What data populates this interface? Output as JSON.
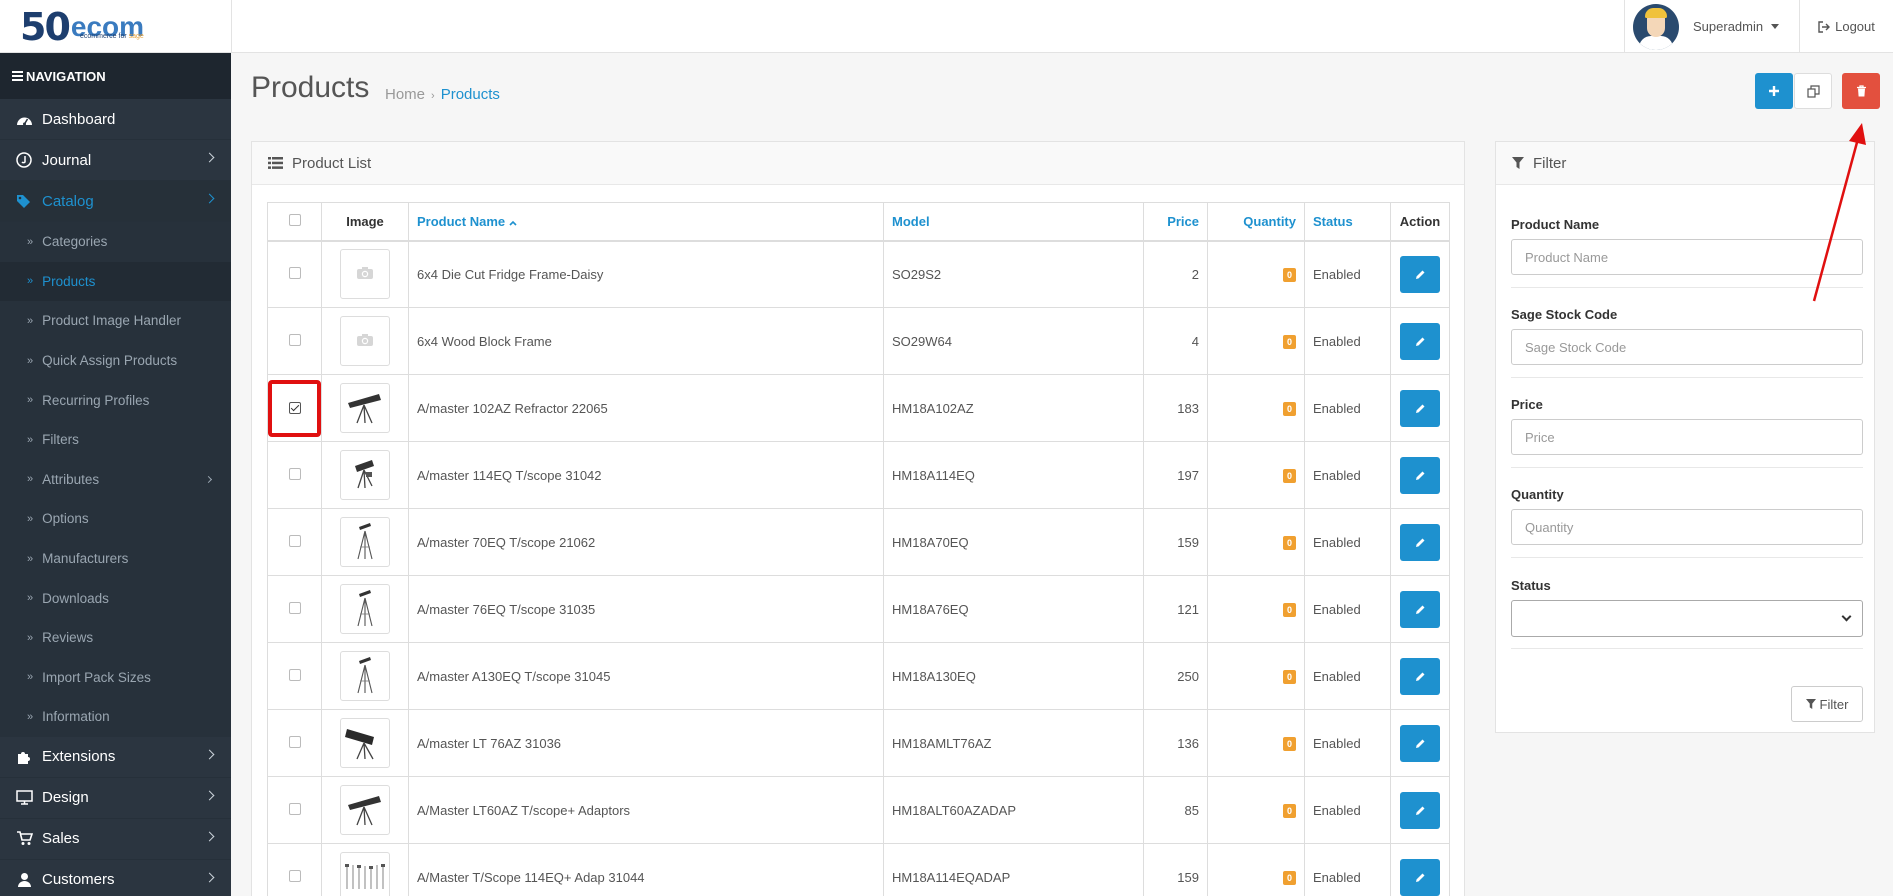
{
  "header": {
    "logo_big": "50",
    "logo_text": "ecom",
    "logo_tag": "ecommerce for",
    "logo_tag_accent": "sage",
    "user_name": "Superadmin",
    "logout_label": "Logout"
  },
  "sidebar": {
    "title": "NAVIGATION",
    "dashboard": "Dashboard",
    "journal": "Journal",
    "catalog": "Catalog",
    "sub": [
      {
        "label": "Categories"
      },
      {
        "label": "Products"
      },
      {
        "label": "Product Image Handler"
      },
      {
        "label": "Quick Assign Products"
      },
      {
        "label": "Recurring Profiles"
      },
      {
        "label": "Filters"
      },
      {
        "label": "Attributes"
      },
      {
        "label": "Options"
      },
      {
        "label": "Manufacturers"
      },
      {
        "label": "Downloads"
      },
      {
        "label": "Reviews"
      },
      {
        "label": "Import Pack Sizes"
      },
      {
        "label": "Information"
      }
    ],
    "extensions": "Extensions",
    "design": "Design",
    "sales": "Sales",
    "customers": "Customers"
  },
  "page": {
    "title": "Products",
    "breadcrumb_home": "Home",
    "breadcrumb_sep": "›",
    "breadcrumb_current": "Products"
  },
  "product_list": {
    "title": "Product List",
    "columns": {
      "image": "Image",
      "name": "Product Name",
      "model": "Model",
      "price": "Price",
      "quantity": "Quantity",
      "status": "Status",
      "action": "Action"
    },
    "rows": [
      {
        "name": "6x4 Die Cut Fridge Frame-Daisy",
        "model": "SO29S2",
        "price": "2",
        "quantity": "0",
        "status": "Enabled",
        "image": "placeholder",
        "checked": false
      },
      {
        "name": "6x4 Wood Block Frame",
        "model": "SO29W64",
        "price": "4",
        "quantity": "0",
        "status": "Enabled",
        "image": "placeholder",
        "checked": false
      },
      {
        "name": "A/master 102AZ Refractor 22065",
        "model": "HM18A102AZ",
        "price": "183",
        "quantity": "0",
        "status": "Enabled",
        "image": "telescope-refractor",
        "checked": true
      },
      {
        "name": "A/master 114EQ T/scope 31042",
        "model": "HM18A114EQ",
        "price": "197",
        "quantity": "0",
        "status": "Enabled",
        "image": "telescope-mount",
        "checked": false
      },
      {
        "name": "A/master 70EQ T/scope 21062",
        "model": "HM18A70EQ",
        "price": "159",
        "quantity": "0",
        "status": "Enabled",
        "image": "telescope-tripod",
        "checked": false
      },
      {
        "name": "A/master 76EQ T/scope 31035",
        "model": "HM18A76EQ",
        "price": "121",
        "quantity": "0",
        "status": "Enabled",
        "image": "telescope-tripod",
        "checked": false
      },
      {
        "name": "A/master A130EQ T/scope 31045",
        "model": "HM18A130EQ",
        "price": "250",
        "quantity": "0",
        "status": "Enabled",
        "image": "telescope-tripod",
        "checked": false
      },
      {
        "name": "A/master LT 76AZ 31036",
        "model": "HM18AMLT76AZ",
        "price": "136",
        "quantity": "0",
        "status": "Enabled",
        "image": "telescope-reflector",
        "checked": false
      },
      {
        "name": "A/Master LT60AZ T/scope+ Adaptors",
        "model": "HM18ALT60AZADAP",
        "price": "85",
        "quantity": "0",
        "status": "Enabled",
        "image": "telescope-refractor",
        "checked": false
      },
      {
        "name": "A/Master T/Scope 114EQ+ Adap 31044",
        "model": "HM18A114EQADAP",
        "price": "159",
        "quantity": "0",
        "status": "Enabled",
        "image": "telescope-set",
        "checked": false
      }
    ]
  },
  "filter": {
    "title": "Filter",
    "product_name_label": "Product Name",
    "product_name_placeholder": "Product Name",
    "stock_code_label": "Sage Stock Code",
    "stock_code_placeholder": "Sage Stock Code",
    "price_label": "Price",
    "price_placeholder": "Price",
    "quantity_label": "Quantity",
    "quantity_placeholder": "Quantity",
    "status_label": "Status",
    "status_value": "",
    "button_label": "Filter"
  },
  "colors": {
    "primary": "#1e91cf",
    "danger": "#e3503e",
    "sidebar": "#2b3540",
    "badge": "#f0a030"
  }
}
